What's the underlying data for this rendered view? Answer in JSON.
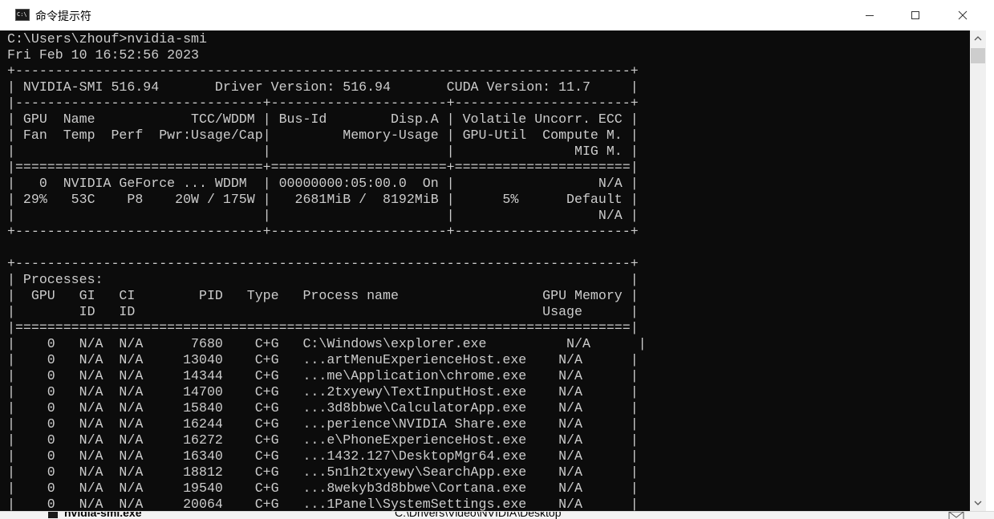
{
  "window": {
    "title": "命令提示符",
    "icon": "cmd-console-icon",
    "icon_text": "C:\\"
  },
  "console": {
    "text": "C:\\Users\\zhouf>nvidia-smi\nFri Feb 10 16:52:56 2023\n+-----------------------------------------------------------------------------+\n| NVIDIA-SMI 516.94       Driver Version: 516.94       CUDA Version: 11.7     |\n|-------------------------------+----------------------+----------------------+\n| GPU  Name            TCC/WDDM | Bus-Id        Disp.A | Volatile Uncorr. ECC |\n| Fan  Temp  Perf  Pwr:Usage/Cap|         Memory-Usage | GPU-Util  Compute M. |\n|                               |                      |               MIG M. |\n|===============================+======================+======================|\n|   0  NVIDIA GeForce ... WDDM  | 00000000:05:00.0  On |                  N/A |\n| 29%   53C    P8    20W / 175W |   2681MiB /  8192MiB |      5%      Default |\n|                               |                      |                  N/A |\n+-------------------------------+----------------------+----------------------+\n\n+-----------------------------------------------------------------------------+\n| Processes:                                                                  |\n|  GPU   GI   CI        PID   Type   Process name                  GPU Memory |\n|        ID   ID                                                   Usage      |\n|=============================================================================|\n|    0   N/A  N/A      7680    C+G   C:\\Windows\\explorer.exe          N/A      |\n|    0   N/A  N/A     13040    C+G   ...artMenuExperienceHost.exe    N/A      |\n|    0   N/A  N/A     14344    C+G   ...me\\Application\\chrome.exe    N/A      |\n|    0   N/A  N/A     14700    C+G   ...2txyewy\\TextInputHost.exe    N/A      |\n|    0   N/A  N/A     15840    C+G   ...3d8bbwe\\CalculatorApp.exe    N/A      |\n|    0   N/A  N/A     16244    C+G   ...perience\\NVIDIA Share.exe    N/A      |\n|    0   N/A  N/A     16272    C+G   ...e\\PhoneExperienceHost.exe    N/A      |\n|    0   N/A  N/A     16340    C+G   ...1432.127\\DesktopMgr64.exe    N/A      |\n|    0   N/A  N/A     18812    C+G   ...5n1h2txyewy\\SearchApp.exe    N/A      |\n|    0   N/A  N/A     19540    C+G   ...8wekyb3d8bbwe\\Cortana.exe    N/A      |\n|    0   N/A  N/A     20064    C+G   ...1Panel\\SystemSettings.exe    N/A      |"
  },
  "taskbar": {
    "file_label": "nvidia-smi.exe",
    "path_label": "C:\\Drivers\\Video\\NVIDIA\\Desktop"
  },
  "colors": {
    "console_bg": "#0c0c0c",
    "console_fg": "#cccccc"
  }
}
